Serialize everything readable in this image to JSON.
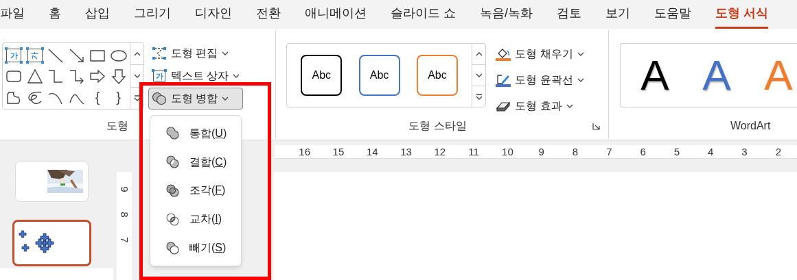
{
  "tabs": [
    {
      "label": "파일",
      "selected": false
    },
    {
      "label": "홈",
      "selected": false
    },
    {
      "label": "삽입",
      "selected": false
    },
    {
      "label": "그리기",
      "selected": false
    },
    {
      "label": "디자인",
      "selected": false
    },
    {
      "label": "전환",
      "selected": false
    },
    {
      "label": "애니메이션",
      "selected": false
    },
    {
      "label": "슬라이드 쇼",
      "selected": false
    },
    {
      "label": "녹음/녹화",
      "selected": false
    },
    {
      "label": "검토",
      "selected": false
    },
    {
      "label": "보기",
      "selected": false
    },
    {
      "label": "도움말",
      "selected": false
    },
    {
      "label": "도형 서식",
      "selected": true
    }
  ],
  "ribbon": {
    "insert_shapes": {
      "shapes": [
        {
          "kind": "textbox",
          "glyph": "가"
        },
        {
          "kind": "vtextbox",
          "glyph": "가"
        },
        {
          "kind": "line"
        },
        {
          "kind": "arrow"
        },
        {
          "kind": "rect"
        },
        {
          "kind": "oval"
        },
        {
          "kind": "roundrect"
        },
        {
          "kind": "triangle"
        },
        {
          "kind": "elbow"
        },
        {
          "kind": "elbowarrow"
        },
        {
          "kind": "rightarrow"
        },
        {
          "kind": "downarrow"
        },
        {
          "kind": "freeform"
        },
        {
          "kind": "scribble"
        },
        {
          "kind": "arc"
        },
        {
          "kind": "curve"
        },
        {
          "kind": "brace",
          "glyph": "{"
        },
        {
          "kind": "brace",
          "glyph": "}"
        }
      ],
      "commands": [
        {
          "kind": "edit",
          "label": "도형 편집",
          "expanded": false
        },
        {
          "kind": "textbox",
          "label": "텍스트 상자",
          "glyph": "가",
          "expanded": false
        },
        {
          "kind": "merge",
          "label": "도형 병합",
          "expanded": true
        }
      ],
      "group_label": "도형"
    },
    "shape_styles": {
      "presets": [
        {
          "label": "Abc",
          "color": "#000000"
        },
        {
          "label": "Abc",
          "color": "#4472c4"
        },
        {
          "label": "Abc",
          "color": "#ed7d31"
        }
      ],
      "commands": [
        {
          "kind": "fill",
          "label": "도형 채우기",
          "color": "#ed7d31"
        },
        {
          "kind": "outline",
          "label": "도형 윤곽선",
          "color": "#4472c4"
        },
        {
          "kind": "effects",
          "label": "도형 효과"
        }
      ],
      "group_label": "도형 스타일"
    },
    "wordart": {
      "presets": [
        {
          "label": "A",
          "kind": "solid",
          "color": "#000000"
        },
        {
          "label": "A",
          "kind": "solid",
          "color": "#4472c4"
        },
        {
          "label": "A",
          "kind": "outline",
          "color": "#ed7d31"
        }
      ],
      "group_label": "WordArt"
    }
  },
  "merge_menu": {
    "items": [
      {
        "kind": "union",
        "label": "통합(U)"
      },
      {
        "kind": "combine",
        "label": "결합(C)"
      },
      {
        "kind": "fragment",
        "label": "조각(F)"
      },
      {
        "kind": "intersect",
        "label": "교차(I)"
      },
      {
        "kind": "subtract",
        "label": "빼기(S)"
      }
    ]
  },
  "slides": [
    {
      "kind": "picture",
      "selected": false
    },
    {
      "kind": "shapes",
      "selected": true
    }
  ],
  "horizontal_ruler": [
    "16",
    "15",
    "14",
    "13",
    "12",
    "11",
    "10",
    "9",
    "8",
    "7",
    "6",
    "5",
    "4",
    "3",
    "2"
  ],
  "vertical_ruler": [
    "9",
    "8",
    "7"
  ]
}
